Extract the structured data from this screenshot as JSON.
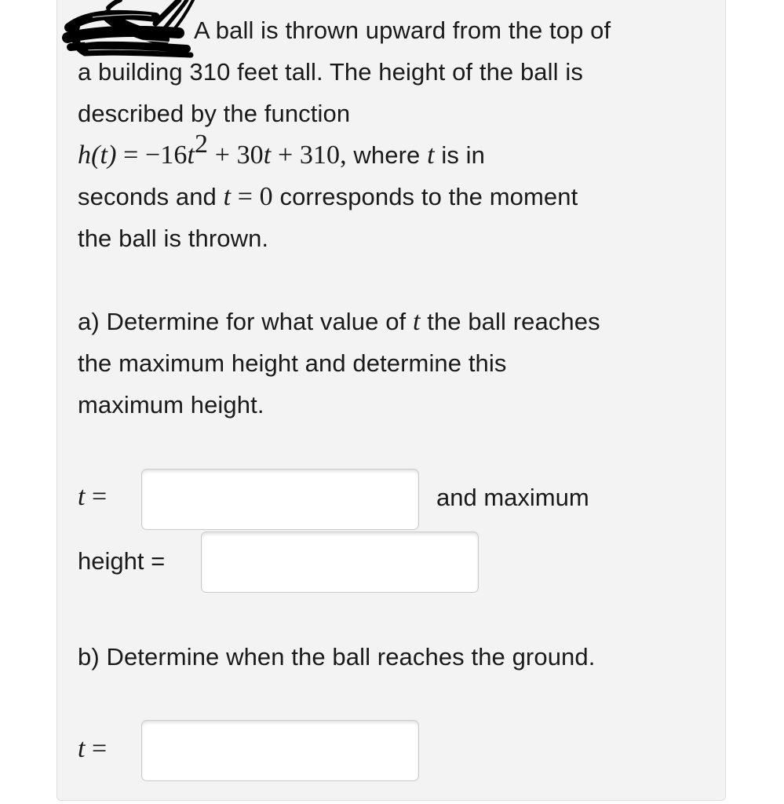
{
  "problem": {
    "intro_line1": "A ball is thrown upward from the top of",
    "intro_line2": "a building 310 feet tall. The height of the ball is",
    "intro_line3": "described by the function",
    "function_lhs": "h(t)",
    "function_eq": " = −16",
    "function_t1": "t",
    "function_exp": "2",
    "function_mid": " + 30",
    "function_t2": "t",
    "function_end": " + 310,",
    "where_text": " where ",
    "where_t": "t",
    "where_rest": " is in",
    "line5_prefix": "seconds and ",
    "line5_t": "t",
    "line5_eq": " = 0",
    "line5_rest": " corresponds to the moment",
    "line6": "the ball is thrown."
  },
  "part_a": {
    "prompt_line1_prefix": "a) Determine for what value of ",
    "prompt_line1_var": "t",
    "prompt_line1_suffix": " the ball reaches",
    "prompt_line2": "the maximum height and determine this",
    "prompt_line3": "maximum height.",
    "t_label_var": "t",
    "t_label_eq": " =",
    "t_value": "",
    "after_t_text": "and maximum",
    "height_label": "height =",
    "height_value": ""
  },
  "part_b": {
    "prompt": "b) Determine when the ball reaches the ground.",
    "t_label_var": "t",
    "t_label_eq": " =",
    "t_value": ""
  },
  "annotations": {
    "redaction_icon": "scribble-redaction"
  }
}
